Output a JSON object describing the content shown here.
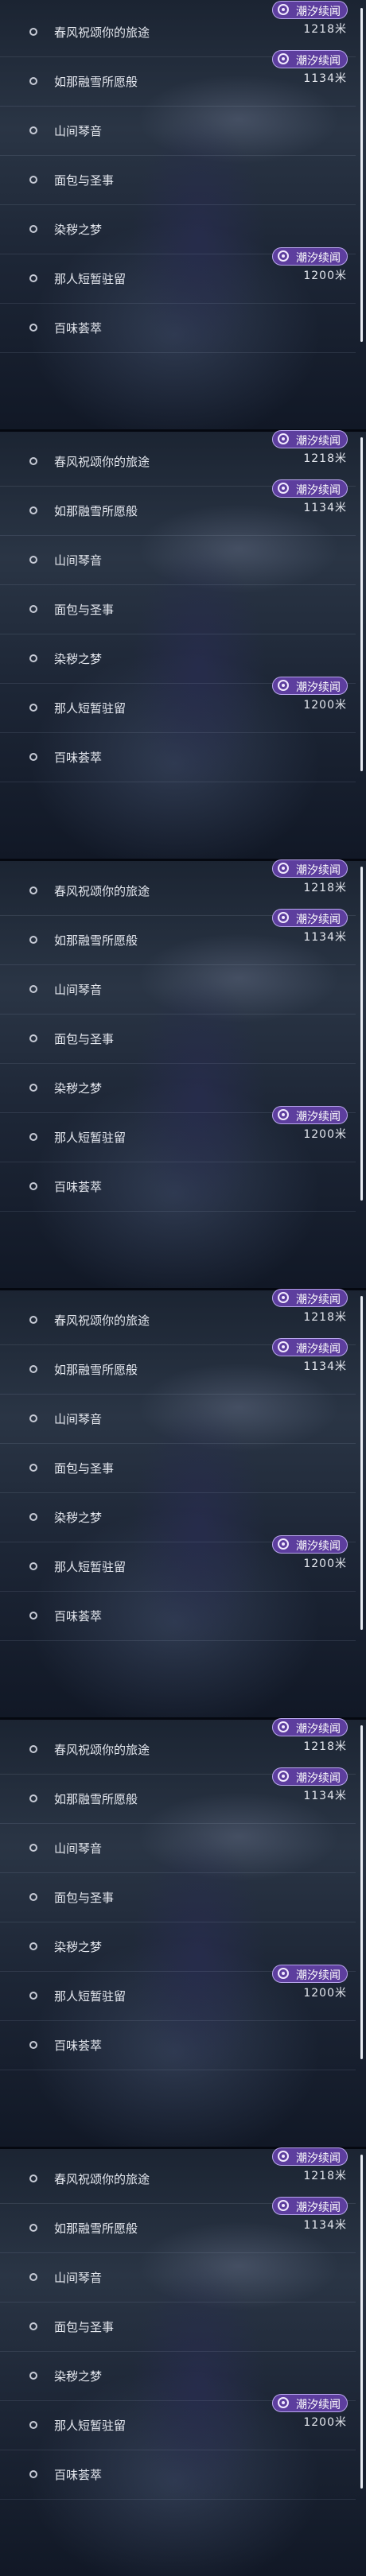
{
  "promo_label": "潮汐续闻",
  "distance_unit": "米",
  "panels": [
    {
      "items": [
        {
          "name": "春风祝颂你的旅途",
          "distance": "1218",
          "promo": true
        },
        {
          "name": "如那融雪所愿般",
          "distance": "1134",
          "promo": true
        },
        {
          "name": "山间琴音"
        },
        {
          "name": "面包与圣事"
        },
        {
          "name": "染秽之梦"
        },
        {
          "name": "那人短暂驻留",
          "distance": "1200",
          "promo": true
        },
        {
          "name": "百味荟萃"
        }
      ]
    },
    {
      "items": [
        {
          "name": "春风祝颂你的旅途",
          "distance": "1218",
          "promo": true
        },
        {
          "name": "如那融雪所愿般",
          "distance": "1134",
          "promo": true
        },
        {
          "name": "山间琴音"
        },
        {
          "name": "面包与圣事"
        },
        {
          "name": "染秽之梦"
        },
        {
          "name": "那人短暂驻留",
          "distance": "1200",
          "promo": true
        },
        {
          "name": "百味荟萃"
        }
      ]
    },
    {
      "items": [
        {
          "name": "春风祝颂你的旅途",
          "distance": "1218",
          "promo": true
        },
        {
          "name": "如那融雪所愿般",
          "distance": "1134",
          "promo": true
        },
        {
          "name": "山间琴音"
        },
        {
          "name": "面包与圣事"
        },
        {
          "name": "染秽之梦"
        },
        {
          "name": "那人短暂驻留",
          "distance": "1200",
          "promo": true
        },
        {
          "name": "百味荟萃"
        }
      ]
    },
    {
      "items": [
        {
          "name": "春风祝颂你的旅途",
          "distance": "1218",
          "promo": true
        },
        {
          "name": "如那融雪所愿般",
          "distance": "1134",
          "promo": true
        },
        {
          "name": "山间琴音"
        },
        {
          "name": "面包与圣事"
        },
        {
          "name": "染秽之梦"
        },
        {
          "name": "那人短暂驻留",
          "distance": "1200",
          "promo": true
        },
        {
          "name": "百味荟萃"
        }
      ]
    },
    {
      "items": [
        {
          "name": "春风祝颂你的旅途",
          "distance": "1218",
          "promo": true
        },
        {
          "name": "如那融雪所愿般",
          "distance": "1134",
          "promo": true
        },
        {
          "name": "山间琴音"
        },
        {
          "name": "面包与圣事"
        },
        {
          "name": "染秽之梦"
        },
        {
          "name": "那人短暂驻留",
          "distance": "1200",
          "promo": true
        },
        {
          "name": "百味荟萃"
        }
      ]
    },
    {
      "items": [
        {
          "name": "春风祝颂你的旅途",
          "distance": "1218",
          "promo": true
        },
        {
          "name": "如那融雪所愿般",
          "distance": "1134",
          "promo": true
        },
        {
          "name": "山间琴音"
        },
        {
          "name": "面包与圣事"
        },
        {
          "name": "染秽之梦"
        },
        {
          "name": "那人短暂驻留",
          "distance": "1200",
          "promo": true
        },
        {
          "name": "百味荟萃"
        }
      ]
    }
  ]
}
